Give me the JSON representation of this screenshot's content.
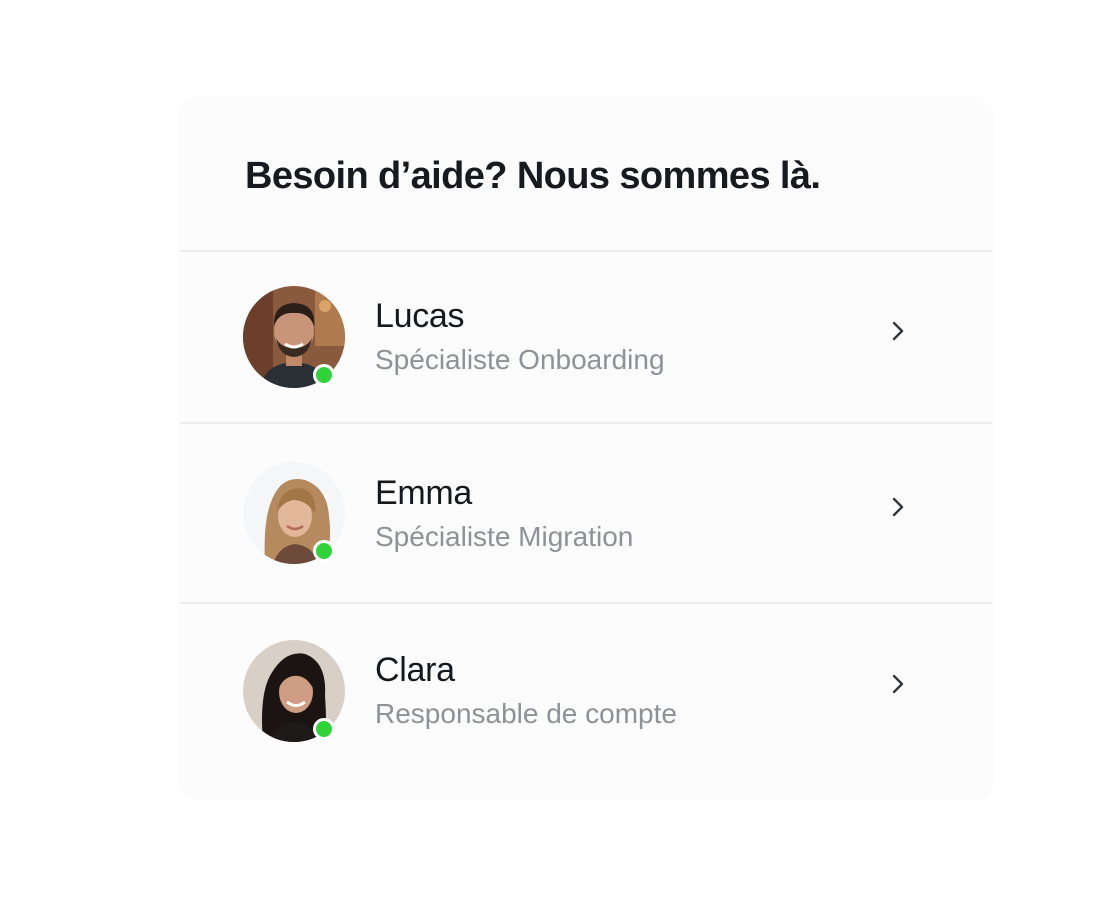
{
  "title": "Besoin d’aide? Nous sommes là.",
  "contacts": [
    {
      "name": "Lucas",
      "role": "Spécialiste Onboarding",
      "status": "online",
      "avatar_icon": "man-portrait"
    },
    {
      "name": "Emma",
      "role": "Spécialiste Migration",
      "status": "online",
      "avatar_icon": "woman-portrait-blonde"
    },
    {
      "name": "Clara",
      "role": "Responsable de compte",
      "status": "online",
      "avatar_icon": "woman-portrait-dark-hair"
    }
  ],
  "colors": {
    "status_online": "#31d33a",
    "title": "#171b1f",
    "role_text": "#8e9196"
  },
  "icons": {
    "row_action": "chevron-right-icon"
  }
}
